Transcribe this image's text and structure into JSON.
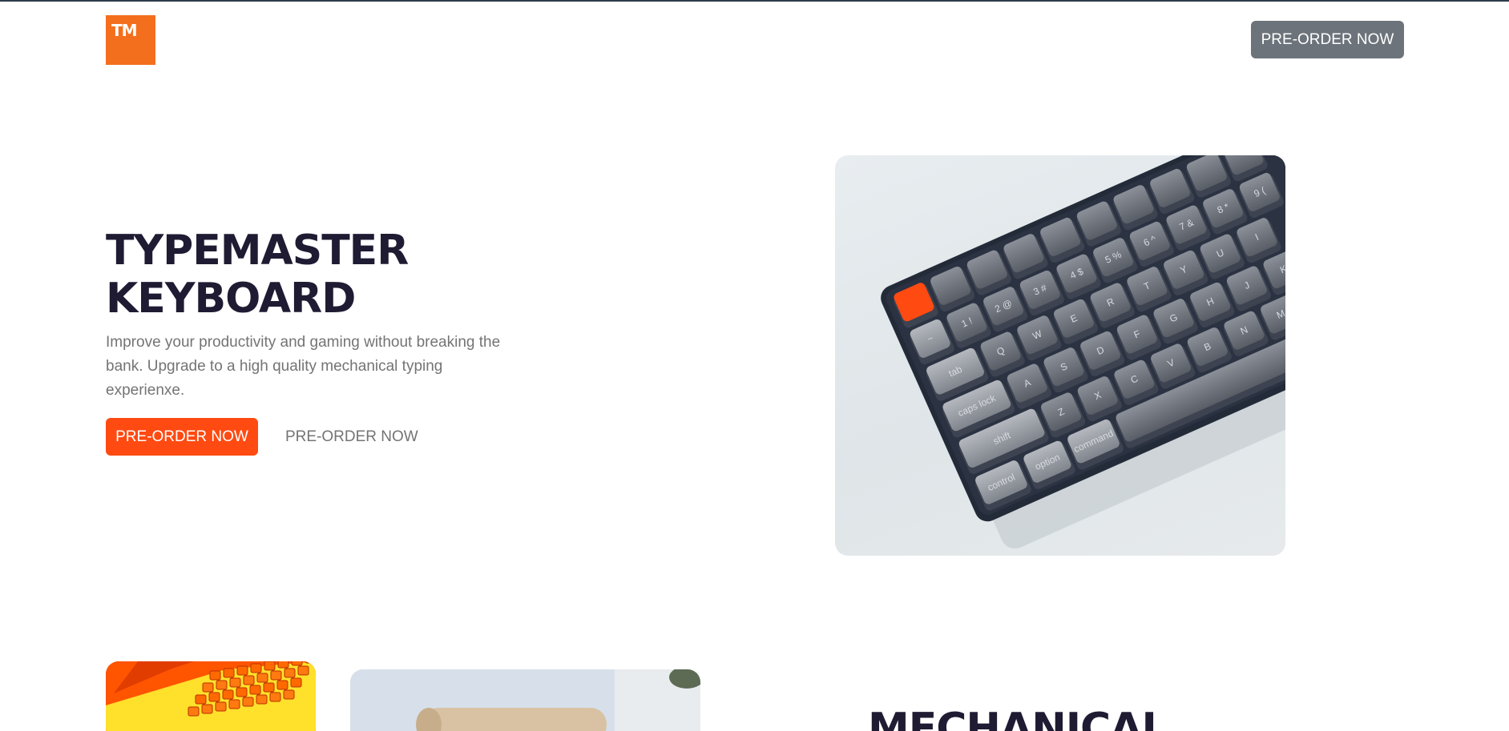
{
  "header": {
    "logo_text": "TM",
    "cta_label": "PRE-ORDER NOW"
  },
  "hero": {
    "title_line1": "TYPEMASTER",
    "title_line2": "KEYBOARD",
    "description": "Improve your productivity and gaming without breaking the bank. Upgrade to a high quality mechanical typing experienxe.",
    "primary_cta": "PRE-ORDER NOW",
    "secondary_cta": "PRE-ORDER NOW"
  },
  "keyboard_image": {
    "row1": [
      "",
      "",
      "",
      "",
      "",
      "",
      "",
      "",
      ""
    ],
    "row2": [
      "1 !",
      "2 @",
      "3 #",
      "4 $",
      "5 %",
      "6 ^",
      "7 &",
      "8 *",
      "9 ("
    ],
    "row3": [
      "Q",
      "W",
      "E",
      "R",
      "T",
      "Y",
      "U",
      "I"
    ],
    "row4": [
      "A",
      "S",
      "D",
      "F",
      "G",
      "H",
      "J",
      "K"
    ],
    "row5": [
      "Z",
      "X",
      "C",
      "V",
      "B",
      "N",
      "M"
    ],
    "mods": [
      "tab",
      "caps lock",
      "shift",
      "control",
      "option",
      "command"
    ]
  },
  "lower": {
    "title": "MECHANICAL"
  },
  "colors": {
    "accent": "#ff4a12",
    "logo": "#f46f1d",
    "header_button": "#6c737b",
    "heading": "#1e1b33",
    "body_text": "#747474"
  }
}
